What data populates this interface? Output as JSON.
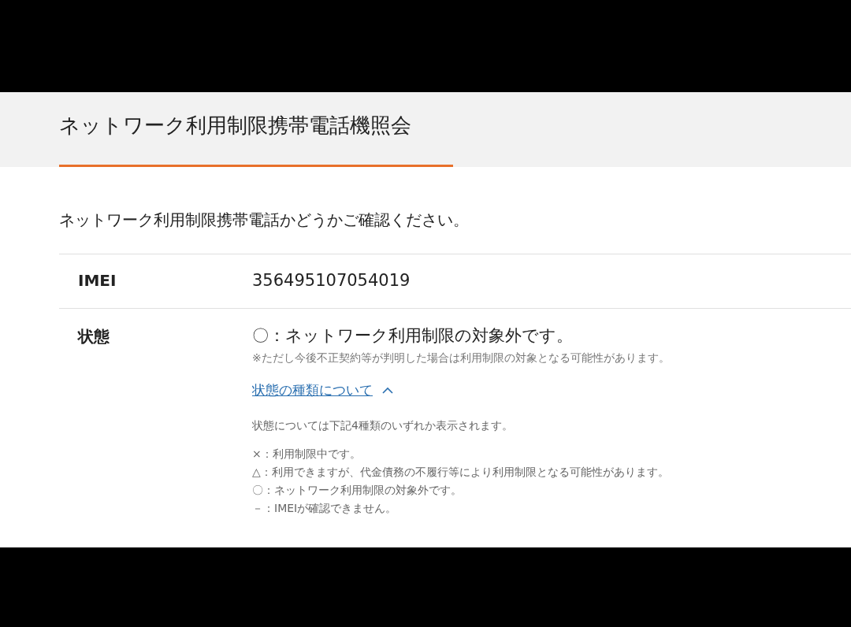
{
  "page_title": "ネットワーク利用制限携帯電話機照会",
  "intro": "ネットワーク利用制限携帯電話かどうかご確認ください。",
  "rows": [
    {
      "kind": "imei",
      "label": "IMEI",
      "value": "356495107054019"
    },
    {
      "kind": "status",
      "label": "状態",
      "value": "〇：ネットワーク利用制限の対象外です。",
      "note": "※ただし今後不正契約等が判明した場合は利用制限の対象となる可能性があります。"
    }
  ],
  "details": {
    "link": "状態の種類について",
    "expanded": true,
    "description": "状態については下記4種類のいずれか表示されます。",
    "items": [
      "×：利用制限中です。",
      "△：利用できますが、代金債務の不履行等により利用制限となる可能性があります。",
      "〇：ネットワーク利用制限の対象外です。",
      "－：IMEIが確認できません。"
    ]
  }
}
